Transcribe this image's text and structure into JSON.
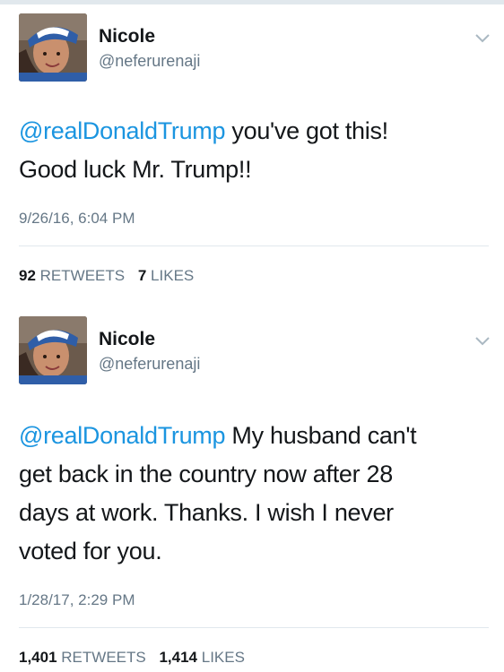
{
  "tweets": [
    {
      "name": "Nicole",
      "handle": "@neferurenaji",
      "mention": "@realDonaldTrump",
      "text_line1": " you've got this!",
      "text_line2": "Good luck Mr. Trump!!",
      "timestamp": "9/26/16, 6:04 PM",
      "retweets": "92",
      "retweets_label": "RETWEETS",
      "likes": "7",
      "likes_label": "LIKES"
    },
    {
      "name": "Nicole",
      "handle": "@neferurenaji",
      "mention": "@realDonaldTrump",
      "text_line1": " My husband can't",
      "text_line2": "get back in the country now after 28",
      "text_line3": "days at work.  Thanks.  I wish I never",
      "text_line4": "voted for you.",
      "timestamp": "1/28/17, 2:29 PM",
      "retweets": "1,401",
      "retweets_label": "RETWEETS",
      "likes": "1,414",
      "likes_label": "LIKES"
    }
  ],
  "icons": {
    "caret": "chevron-down-icon",
    "avatar": "avatar"
  },
  "colors": {
    "mention": "#1b95e0",
    "secondary_text": "#657786",
    "primary_text": "#14171a",
    "divider": "#e1e8ed"
  }
}
